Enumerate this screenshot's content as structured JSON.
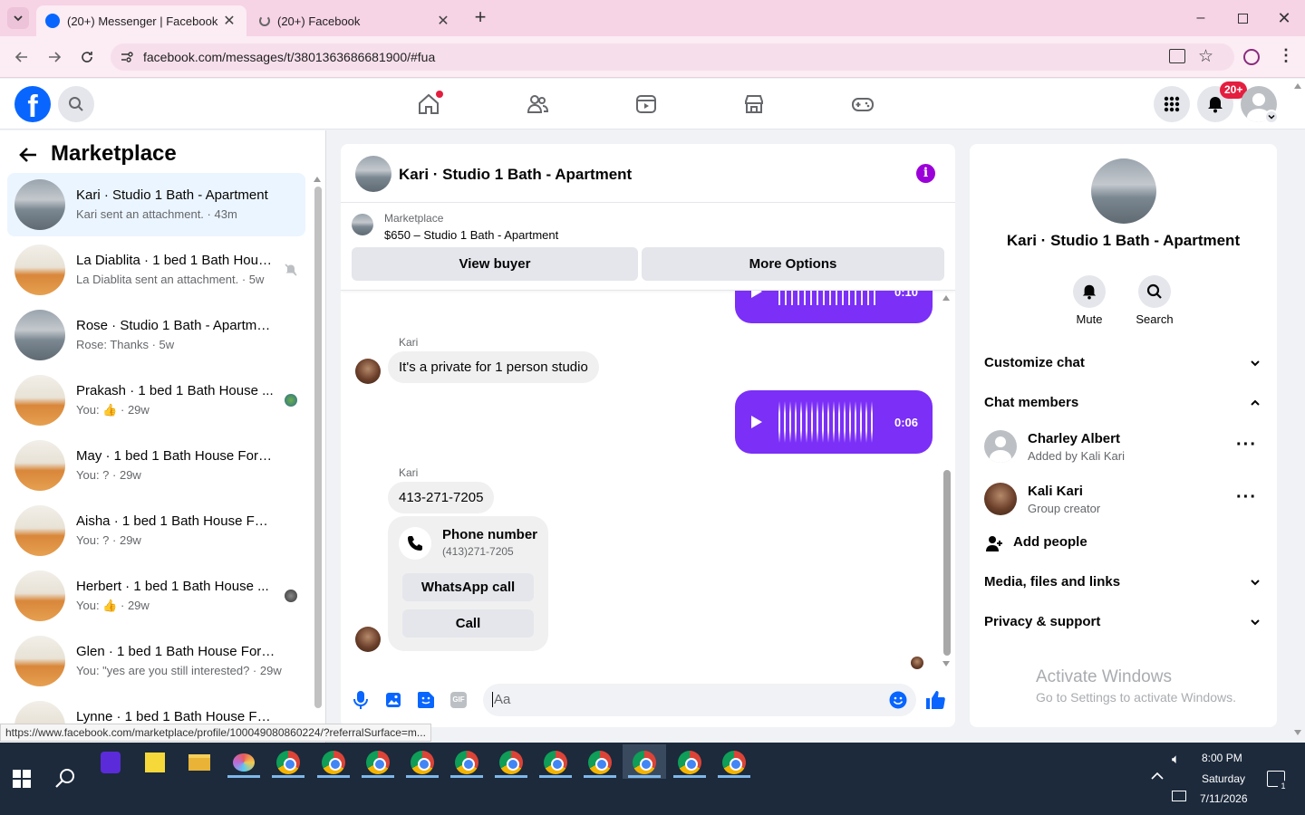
{
  "browser": {
    "tabs": [
      {
        "title": "(20+) Messenger | Facebook",
        "active": true
      },
      {
        "title": "(20+) Facebook",
        "active": false
      }
    ],
    "url": "facebook.com/messages/t/3801363686681900/#fua",
    "status_url": "https://www.facebook.com/marketplace/profile/100049080860224/?referralSurface=m..."
  },
  "header": {
    "notifications_badge": "20+",
    "brand_color": "#0866ff"
  },
  "left": {
    "title": "Marketplace",
    "conversations": [
      {
        "name": "Kari · Studio 1 Bath - Apartment",
        "preview": "Kari sent an attachment.",
        "time": "43m",
        "selected": true,
        "thumb": "apartment"
      },
      {
        "name": "La Diablita · 1 bed 1 Bath Hous...",
        "preview": "La Diablita sent an attachment.",
        "time": "5w",
        "muted": true,
        "thumb": "house"
      },
      {
        "name": "Rose · Studio 1 Bath - Apartment",
        "preview": "Rose: Thanks",
        "time": "5w",
        "thumb": "apartment"
      },
      {
        "name": "Prakash · 1 bed 1 Bath House ...",
        "preview": "You:",
        "time": "29w",
        "like": true,
        "thumb": "house"
      },
      {
        "name": "May · 1 bed 1 Bath House For Rent",
        "preview": "You: ?",
        "time": "29w",
        "thumb": "house"
      },
      {
        "name": "Aisha · 1 bed 1 Bath House For R...",
        "preview": "You: ?",
        "time": "29w",
        "thumb": "house"
      },
      {
        "name": "Herbert · 1 bed 1 Bath House ...",
        "preview": "You:",
        "time": "29w",
        "like": true,
        "thumb": "house"
      },
      {
        "name": "Glen · 1 bed 1 Bath House For Re...",
        "preview": "You: \"yes are you still interested?",
        "time": "29w",
        "thumb": "house"
      },
      {
        "name": "Lynne · 1 bed 1 Bath House Fo...",
        "preview": "",
        "time": "",
        "thumb": "house"
      }
    ]
  },
  "chat": {
    "title": "Kari · Studio 1 Bath - Apartment",
    "listing_label": "Marketplace",
    "listing_title": "$650 – Studio 1 Bath - Apartment",
    "view_buyer": "View buyer",
    "more_options": "More Options",
    "audio1_duration": "0:10",
    "sender1": "Kari",
    "msg1": "It's a private for 1 person studio",
    "audio2_duration": "0:06",
    "sender2": "Kari",
    "msg2": "413-271-7205",
    "phone_card_title": "Phone number",
    "phone_card_number": "(413)271-7205",
    "whatsapp_label": "WhatsApp call",
    "call_label": "Call",
    "input_placeholder": "Aa",
    "accent": "#7b2ff7"
  },
  "info": {
    "name": "Kari · Studio 1 Bath - Apartment",
    "mute_label": "Mute",
    "search_label": "Search",
    "customize": "Customize chat",
    "members_heading": "Chat members",
    "members": [
      {
        "name": "Charley Albert",
        "sub": "Added by Kali Kari"
      },
      {
        "name": "Kali Kari",
        "sub": "Group creator"
      }
    ],
    "add_people": "Add people",
    "media": "Media, files and links",
    "privacy": "Privacy & support",
    "watermark_title": "Activate Windows",
    "watermark_sub": "Go to Settings to activate Windows."
  },
  "taskbar": {
    "time": "8:00 PM",
    "day": "Saturday",
    "date": "7/11/2026",
    "notif_count": "1"
  }
}
